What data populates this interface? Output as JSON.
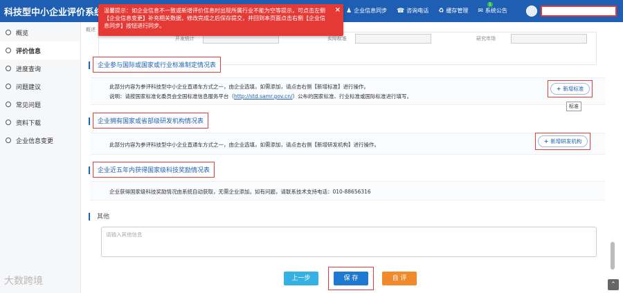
{
  "app": {
    "title": "科技型中小企业评价系统"
  },
  "topnav": {
    "sync": "企业信息同步",
    "consult": "咨询电话",
    "cache": "缓存管理",
    "notice": "系统公告",
    "notice_badge": "1"
  },
  "toast": {
    "text": "温馨提示：如企业信息不一致或新增评价信息时出现所属行业不能为空等提示，可点击左侧【企业信息变更】补充相关数据，修改完成之后保存提交，并回到本页面点击右侧【企业信息同步】按钮进行同步。",
    "close": "×"
  },
  "sidebar": {
    "items": [
      {
        "label": "概览"
      },
      {
        "label": "评价信息"
      },
      {
        "label": "进度查询"
      },
      {
        "label": "问题建议"
      },
      {
        "label": "常见问题"
      },
      {
        "label": "资料下载"
      },
      {
        "label": "企业信息变更"
      }
    ]
  },
  "crumb": "概述",
  "stub": {
    "l1": "开发统计",
    "l2": "实际标准",
    "l3": "研究市场"
  },
  "sections": [
    {
      "title": "企业参与国际或国家或行业标准制定情况表",
      "line1": "此部分内容为参评科技型中小企业直通车方式之一，由企业选填，如需添加，请点击右侧【新增标准】进行操作。",
      "line2_pre": "说明：请按国家标准化委员会全国标准信息服务平台（",
      "line2_link": "http://std.samr.gov.cn/",
      "line2_post": "）公布的国家标准、行业标准或国际标准进行填写。",
      "button": "新增标准",
      "tooltip": "标准"
    },
    {
      "title": "企业拥有国家或省部级研发机构情况表",
      "line1": "此部分内容为参评科技型中小企业直通车方式之一，由企业选填，如需添加，请点击右侧【新增研发机构】进行操作。",
      "button": "新增研发机构"
    },
    {
      "title": "企业近五年内获得国家级科技奖励情况表",
      "line1": "企业获得国家级科技奖励情况由系统自动获取，无需企业添加。如有问题，请联系技术支持电话：010-88656316"
    }
  ],
  "other": {
    "label": "其他",
    "placeholder": "请输入其他信息"
  },
  "buttons": {
    "prev": "上一步",
    "save": "保 存",
    "eval": "自 评"
  },
  "watermark": "大数跨境"
}
